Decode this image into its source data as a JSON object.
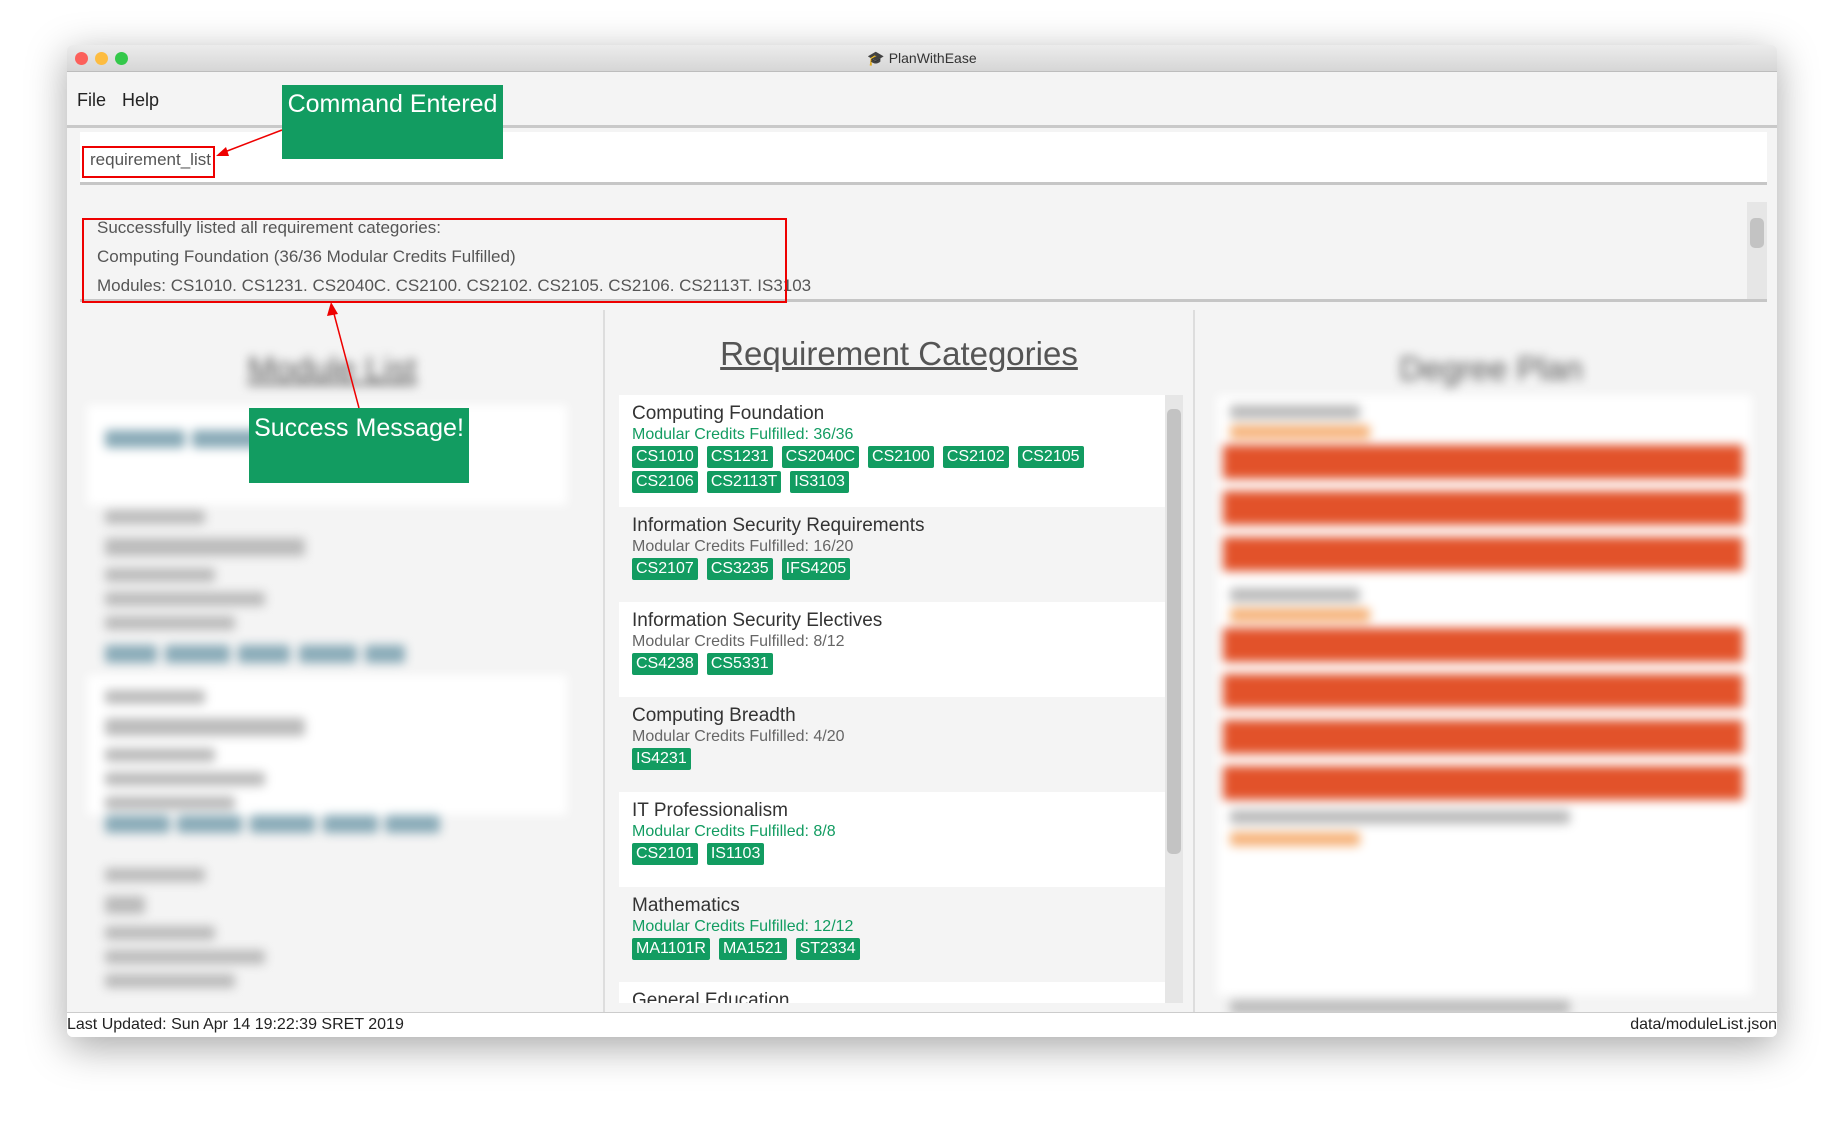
{
  "window": {
    "title": "PlanWithEase",
    "app_icon": "graduation-cap-icon",
    "accent": "#129c61"
  },
  "menu": {
    "file": "File",
    "help": "Help"
  },
  "command": {
    "value": "requirement_list"
  },
  "result": {
    "lines": [
      "Successfully listed all requirement categories:",
      "Computing Foundation (36/36 Modular Credits Fulfilled)",
      "Modules: CS1010. CS1231. CS2040C. CS2100. CS2102. CS2105. CS2106. CS2113T. IS3103"
    ]
  },
  "module_list": {
    "title": "Module List"
  },
  "requirements": {
    "title": "Requirement Categories",
    "items": [
      {
        "name": "Computing Foundation",
        "credits": "Modular Credits Fulfilled: 36/36",
        "fulfilled": true,
        "modules": [
          "CS1010",
          "CS1231",
          "CS2040C",
          "CS2100",
          "CS2102",
          "CS2105",
          "CS2106",
          "CS2113T",
          "IS3103"
        ]
      },
      {
        "name": "Information Security Requirements",
        "credits": "Modular Credits Fulfilled: 16/20",
        "fulfilled": false,
        "modules": [
          "CS2107",
          "CS3235",
          "IFS4205"
        ]
      },
      {
        "name": "Information Security Electives",
        "credits": "Modular Credits Fulfilled: 8/12",
        "fulfilled": false,
        "modules": [
          "CS4238",
          "CS5331"
        ]
      },
      {
        "name": "Computing Breadth",
        "credits": "Modular Credits Fulfilled: 4/20",
        "fulfilled": false,
        "modules": [
          "IS4231"
        ]
      },
      {
        "name": "IT Professionalism",
        "credits": "Modular Credits Fulfilled: 8/8",
        "fulfilled": true,
        "modules": [
          "CS2101",
          "IS1103"
        ]
      },
      {
        "name": "Mathematics",
        "credits": "Modular Credits Fulfilled: 12/12",
        "fulfilled": true,
        "modules": [
          "MA1101R",
          "MA1521",
          "ST2334"
        ]
      },
      {
        "name": "General Education",
        "credits": "",
        "fulfilled": false,
        "modules": []
      }
    ]
  },
  "degree_plan": {
    "title": "Degree Plan"
  },
  "status": {
    "last_updated": "Last Updated: Sun Apr 14 19:22:39 SRET 2019",
    "file": "data/moduleList.json"
  },
  "annotations": {
    "command": "Command Entered",
    "success": "Success Message!"
  }
}
